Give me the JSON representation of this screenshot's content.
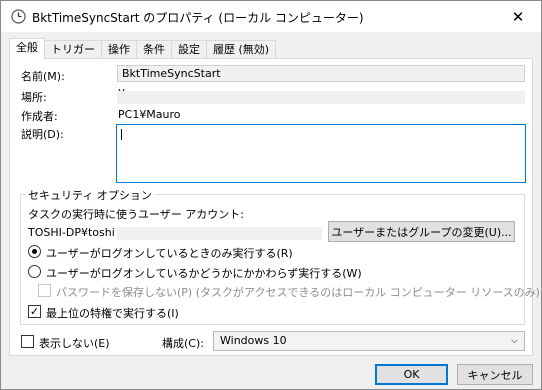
{
  "window": {
    "title": "BktTimeSyncStart のプロパティ (ローカル コンピューター)",
    "title_icon": "clock-icon",
    "close_glyph": "✕"
  },
  "tabs": [
    {
      "label": "全般",
      "active": true
    },
    {
      "label": "トリガー"
    },
    {
      "label": "操作"
    },
    {
      "label": "条件"
    },
    {
      "label": "設定"
    },
    {
      "label": "履歴 (無効)"
    }
  ],
  "general": {
    "name_label": "名前(M):",
    "name_value": "BktTimeSyncStart",
    "location_label": "場所:",
    "location_value": "¥",
    "author_label": "作成者:",
    "author_value": "PC1¥Mauro",
    "description_label": "説明(D):",
    "description_value": ""
  },
  "security": {
    "group_title": "セキュリティ オプション",
    "account_prompt": "タスクの実行時に使うユーザー アカウント:",
    "account_value": "TOSHI-DP¥toshi",
    "change_button": "ユーザーまたはグループの変更(U)...",
    "radio_logged_on_only": "ユーザーがログオンしているときのみ実行する(R)",
    "radio_logged_on_any": "ユーザーがログオンしているかどうかにかかわらず実行する(W)",
    "no_store_password": "パスワードを保存しない(P) (タスクがアクセスできるのはローカル コンピューター リソースのみ)",
    "highest_privileges": "最上位の特権で実行する(I)",
    "highest_privileges_checked": true,
    "check_glyph": "✓"
  },
  "footer": {
    "hidden_label": "表示しない(E)",
    "configure_label": "構成(C):",
    "configure_value": "Windows 10",
    "dropdown_glyph": "⌵",
    "ok_button": "OK",
    "cancel_button": "キャンセル"
  },
  "colors": {
    "accent": "#0078d7",
    "window_bg": "#f0f0f0",
    "panel_bg": "#ffffff"
  }
}
